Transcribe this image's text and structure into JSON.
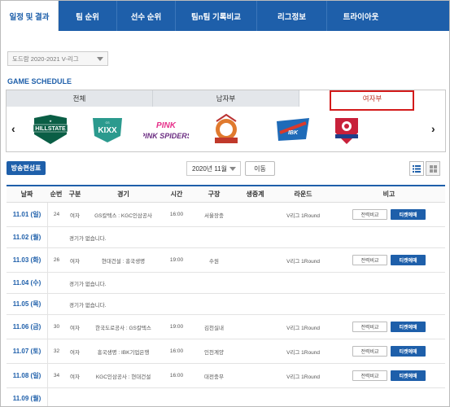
{
  "nav": {
    "tabs": [
      {
        "label": "일정 및 결과",
        "active": true
      },
      {
        "label": "팀 순위"
      },
      {
        "label": "선수 순위"
      },
      {
        "label": "팀n팀 기록비교"
      },
      {
        "label": "리그정보"
      },
      {
        "label": "트라이아웃"
      }
    ]
  },
  "season_select": {
    "value": "도드람 2020-2021 V-리그"
  },
  "section_title": "GAME SCHEDULE",
  "gender_tabs": [
    {
      "label": "전체"
    },
    {
      "label": "남자부"
    },
    {
      "label": "여자부",
      "active": true
    }
  ],
  "teams": [
    {
      "icon": "hillstate-logo",
      "text": "HILLSTATE"
    },
    {
      "icon": "kixx-logo",
      "text": "KIXX"
    },
    {
      "icon": "pink-spiders-logo",
      "text": "PINK SPIDERS"
    },
    {
      "icon": "kgc-logo",
      "text": ""
    },
    {
      "icon": "altos-logo",
      "text": ""
    },
    {
      "icon": "heungkuk-logo",
      "text": ""
    }
  ],
  "controls": {
    "broadcast_label": "방송편성표",
    "month_value": "2020년 11월",
    "move_label": "이동"
  },
  "table": {
    "headers": [
      "날짜",
      "순번",
      "구분",
      "경기",
      "시간",
      "구장",
      "생중계",
      "라운드",
      "비고"
    ],
    "compare_label": "전력비교",
    "ticket_label": "티켓예매",
    "no_game_text": "경기가 없습니다.",
    "rows": [
      {
        "date": "11.01 (일)",
        "no": "24",
        "div": "여자",
        "game": "GS칼텍스 : KGC인삼공사",
        "time": "16:00",
        "venue": "서울장충",
        "round": "V리그 1Round"
      },
      {
        "date": "11.02 (월)"
      },
      {
        "date": "11.03 (화)",
        "no": "26",
        "div": "여자",
        "game": "현대건설 : 흥국생명",
        "time": "19:00",
        "venue": "수원",
        "round": "V리그 1Round"
      },
      {
        "date": "11.04 (수)"
      },
      {
        "date": "11.05 (목)"
      },
      {
        "date": "11.06 (금)",
        "no": "30",
        "div": "여자",
        "game": "한국도로공사 : GS칼텍스",
        "time": "19:00",
        "venue": "김천실내",
        "round": "V리그 1Round"
      },
      {
        "date": "11.07 (토)",
        "no": "32",
        "div": "여자",
        "game": "흥국생명 : IBK기업은행",
        "time": "16:00",
        "venue": "인천계양",
        "round": "V리그 1Round"
      },
      {
        "date": "11.08 (일)",
        "no": "34",
        "div": "여자",
        "game": "KGC인삼공사 : 현대건설",
        "time": "16:00",
        "venue": "대전충무",
        "round": "V리그 1Round"
      },
      {
        "date": "11.09 (월)"
      }
    ]
  }
}
